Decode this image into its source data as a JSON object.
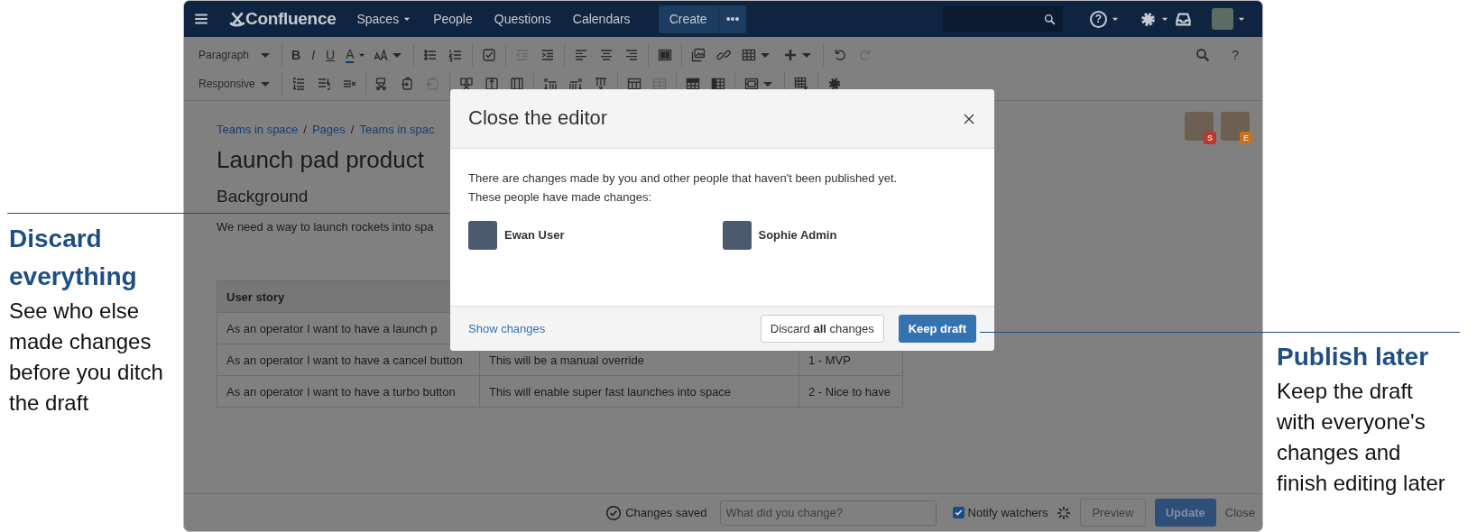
{
  "annotations": [
    {
      "heading": "Discard everything",
      "text": "See who else made changes before you ditch the draft"
    },
    {
      "heading": "Publish later",
      "text": "Keep the draft with everyone's changes and finish editing later"
    }
  ],
  "nav": {
    "logo": "Confluence",
    "items": [
      {
        "label": "Spaces",
        "dropdown": true
      },
      {
        "label": "People",
        "dropdown": false
      },
      {
        "label": "Questions",
        "dropdown": false
      },
      {
        "label": "Calendars",
        "dropdown": false
      }
    ],
    "create": "Create",
    "more": "•••",
    "help": "?"
  },
  "toolbar": {
    "rows": [
      [
        [
          {
            "kind": "dropdown",
            "label": "Paragraph"
          }
        ],
        [
          {
            "kind": "bold",
            "text": "B",
            "caret": false
          },
          {
            "kind": "italic",
            "text": "I",
            "caret": false
          },
          {
            "kind": "underline",
            "text": "U",
            "caret": false
          },
          {
            "kind": "color",
            "text": "A",
            "caret": true
          },
          {
            "kind": "icon",
            "disabled": false,
            "caret": true
          }
        ],
        [
          {
            "kind": "icon",
            "disabled": false,
            "caret": false
          },
          {
            "kind": "icon",
            "disabled": false,
            "caret": false
          }
        ],
        [
          {
            "kind": "icon",
            "disabled": false,
            "caret": false
          }
        ],
        [
          {
            "kind": "icon",
            "disabled": true,
            "caret": false
          },
          {
            "kind": "icon",
            "disabled": false,
            "caret": false
          }
        ],
        [
          {
            "kind": "icon",
            "disabled": false,
            "caret": false
          },
          {
            "kind": "icon",
            "disabled": false,
            "caret": false
          },
          {
            "kind": "icon",
            "disabled": false,
            "caret": false
          }
        ],
        [
          {
            "kind": "icon",
            "disabled": false,
            "caret": false
          }
        ],
        [
          {
            "kind": "icon",
            "disabled": false,
            "caret": false
          },
          {
            "kind": "icon",
            "disabled": false,
            "caret": false
          },
          {
            "kind": "icon",
            "disabled": false,
            "caret": true
          },
          {
            "kind": "icon",
            "disabled": false,
            "caret": true
          }
        ],
        [
          {
            "kind": "icon",
            "disabled": false,
            "caret": false
          },
          {
            "kind": "icon",
            "disabled": true,
            "caret": false
          }
        ]
      ],
      [
        [
          {
            "kind": "dropdown",
            "label": "Responsive"
          }
        ],
        [
          {
            "kind": "icon",
            "disabled": false,
            "caret": false
          },
          {
            "kind": "icon",
            "disabled": false,
            "caret": false
          },
          {
            "kind": "icon",
            "disabled": false,
            "caret": false
          }
        ],
        [
          {
            "kind": "icon",
            "disabled": false,
            "caret": false
          },
          {
            "kind": "icon",
            "disabled": false,
            "caret": false
          },
          {
            "kind": "icon",
            "disabled": true,
            "caret": false
          }
        ],
        [
          {
            "kind": "icon",
            "disabled": false,
            "caret": false
          },
          {
            "kind": "icon",
            "disabled": false,
            "caret": false
          },
          {
            "kind": "icon",
            "disabled": false,
            "caret": false
          }
        ],
        [
          {
            "kind": "icon",
            "disabled": false,
            "caret": false
          },
          {
            "kind": "icon",
            "disabled": false,
            "caret": false
          },
          {
            "kind": "icon",
            "disabled": false,
            "caret": false
          }
        ],
        [
          {
            "kind": "icon",
            "disabled": false,
            "caret": false
          },
          {
            "kind": "icon",
            "disabled": true,
            "caret": false
          }
        ],
        [
          {
            "kind": "icon",
            "disabled": false,
            "caret": false
          },
          {
            "kind": "icon",
            "disabled": false,
            "caret": false
          }
        ],
        [
          {
            "kind": "icon",
            "disabled": false,
            "caret": true
          }
        ],
        [
          {
            "kind": "icon",
            "disabled": false,
            "caret": false
          }
        ],
        [
          {
            "kind": "icon",
            "disabled": false,
            "caret": false
          }
        ]
      ]
    ],
    "right": [
      {
        "kind": "icon",
        "disabled": false,
        "caret": false
      },
      {
        "kind": "glyph",
        "text": "?",
        "caret": false
      }
    ]
  },
  "page": {
    "breadcrumbs": [
      "Teams in space",
      "Pages",
      "Teams in spac"
    ],
    "separator": "/",
    "title": "Launch pad product",
    "heading": "Background",
    "paragraph": "We need a way to launch rockets into spa",
    "collaborators": [
      {
        "badge": "S",
        "color": "#b8392e"
      },
      {
        "badge": "E",
        "color": "#c6731c"
      }
    ],
    "table": {
      "columns": [
        "User story"
      ],
      "rows": [
        {
          "cells": [
            "As an operator I want to have a launch p"
          ]
        },
        {
          "cells": [
            "As an operator I want to have a cancel button",
            "This will be a manual override",
            "1 - MVP"
          ]
        },
        {
          "cells": [
            "As an operator I want to have a turbo button",
            "This will enable super fast launches into space",
            "2 - Nice to have"
          ]
        }
      ]
    }
  },
  "dialog": {
    "title": "Close the editor",
    "message": "There are changes made by you and other people that haven't been published yet.",
    "people_label": "These people have made changes:",
    "people": [
      {
        "name": "Ewan User"
      },
      {
        "name": "Sophie Admin"
      }
    ],
    "show_changes": "Show changes",
    "discard": "Discard **all** changes",
    "keep": "Keep draft"
  },
  "footer": {
    "status": "Changes saved",
    "comment_placeholder": "What did you change?",
    "notify": {
      "label": "Notify watchers",
      "checked": true
    },
    "preview": "Preview",
    "update": {
      "label": "Update",
      "disabled": true
    },
    "close": "Close"
  }
}
